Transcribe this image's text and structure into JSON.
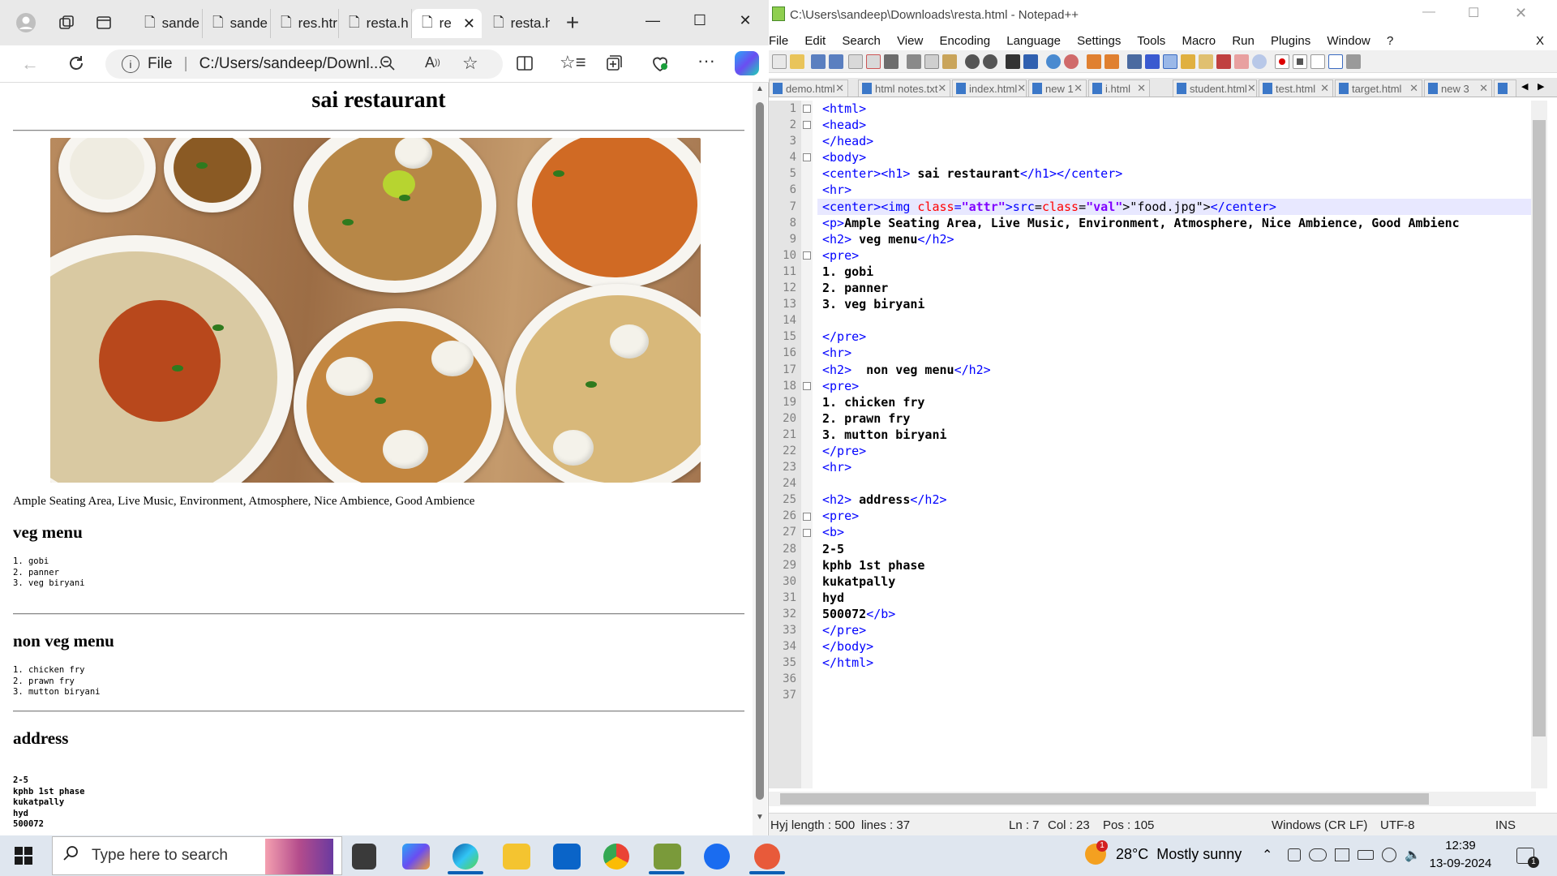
{
  "browser": {
    "tabs": [
      {
        "label": "sande"
      },
      {
        "label": "sande"
      },
      {
        "label": "res.htr"
      },
      {
        "label": "resta.h"
      },
      {
        "label": "re",
        "active": true
      },
      {
        "label": "resta.h"
      }
    ],
    "url_prefix": "File",
    "url": "C:/Users/sandeep/Downl...",
    "page": {
      "title": "sai restaurant",
      "image_alt": "food.jpg",
      "tagline": "Ample Seating Area, Live Music, Environment, Atmosphere, Nice Ambience, Good Ambience",
      "veg_heading": "veg menu",
      "veg_items": "1. gobi\n2. panner\n3. veg biryani",
      "nonveg_heading": "non veg menu",
      "nonveg_items": "1. chicken fry\n2. prawn fry\n3. mutton biryani",
      "address_heading": "address",
      "address_lines": "2-5\nkphb 1st phase\nkukatpally\nhyd\n500072"
    }
  },
  "notepad": {
    "title": "C:\\Users\\sandeep\\Downloads\\resta.html - Notepad++",
    "menu": [
      "File",
      "Edit",
      "Search",
      "View",
      "Encoding",
      "Language",
      "Settings",
      "Tools",
      "Macro",
      "Run",
      "Plugins",
      "Window",
      "?"
    ],
    "close_x": "X",
    "tabs": [
      "demo.html",
      "html notes.txt",
      "index.html",
      "new 1",
      "i.html",
      "student.html",
      "test.html",
      "target.html",
      "new 3"
    ],
    "line_numbers": [
      "1",
      "2",
      "3",
      "4",
      "5",
      "6",
      "7",
      "8",
      "9",
      "10",
      "11",
      "12",
      "13",
      "14",
      "15",
      "16",
      "17",
      "18",
      "19",
      "20",
      "21",
      "22",
      "23",
      "24",
      "25",
      "26",
      "27",
      "28",
      "29",
      "30",
      "31",
      "32",
      "33",
      "34",
      "35",
      "36",
      "37"
    ],
    "code_lines": [
      "<html>",
      "<head>",
      "</head>",
      "<body>",
      "<center><h1> sai restaurant</h1></center>",
      "<hr>",
      "<center><img src=\"food.jpg\"></center>",
      "<p>Ample Seating Area, Live Music, Environment, Atmosphere, Nice Ambience, Good Ambienc",
      "<h2> veg menu</h2>",
      "<pre>",
      "1. gobi",
      "2. panner",
      "3. veg biryani",
      "",
      "</pre>",
      "<hr>",
      "<h2>  non veg menu</h2>",
      "<pre>",
      "1. chicken fry",
      "2. prawn fry",
      "3. mutton biryani",
      "</pre>",
      "<hr>",
      "",
      "<h2> address</h2>",
      "<pre>",
      "<b>",
      "2-5",
      "kphb 1st phase",
      "kukatpally",
      "hyd",
      "500072</b>",
      "</pre>",
      "</body>",
      "</html>",
      "",
      ""
    ],
    "current_line": 7,
    "status": {
      "length": "Hyj length : 500",
      "lines": "lines : 37",
      "ln": "Ln : 7",
      "col": "Col : 23",
      "pos": "Pos : 105",
      "eol": "Windows (CR LF)",
      "encoding": "UTF-8",
      "mode": "INS"
    }
  },
  "taskbar": {
    "search_placeholder": "Type here to search",
    "weather": "28°C  Mostly sunny",
    "weather_badge": "1",
    "time": "12:39",
    "date": "13-09-2024",
    "notification_count": "1"
  }
}
